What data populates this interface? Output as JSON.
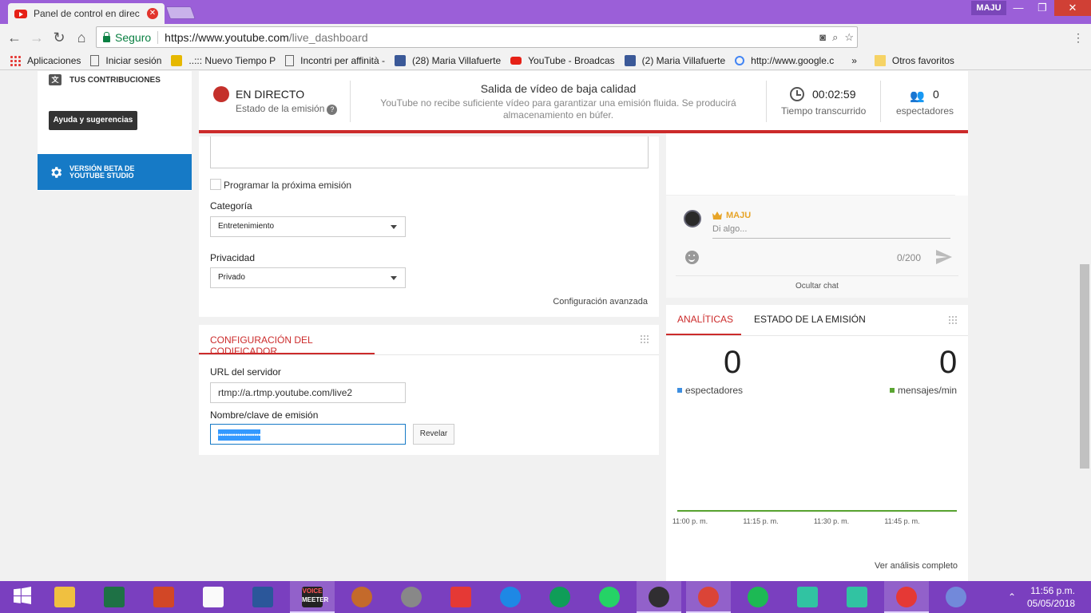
{
  "browser": {
    "tab_title": "Panel de control en direc",
    "tab_close": "✕",
    "profile": "MAJU",
    "window_controls": {
      "minimize": "—",
      "restore": "❐",
      "close": "✕"
    },
    "nav": {
      "back": "←",
      "forward": "→",
      "reload": "↻",
      "home": "⌂"
    },
    "secure_label": "Seguro",
    "url_host": "https://www.youtube.com",
    "url_path": "/live_dashboard",
    "bookmarks": [
      {
        "label": "Aplicaciones",
        "icon": "apps-grid-icon"
      },
      {
        "label": "Iniciar sesión",
        "icon": "page-icon"
      },
      {
        "label": "..::: Nuevo Tiempo P",
        "icon": "shield-icon"
      },
      {
        "label": "Incontri per affinità -",
        "icon": "eharmony-icon"
      },
      {
        "label": "(28) Maria Villafuerte",
        "icon": "facebook-icon"
      },
      {
        "label": "YouTube - Broadcas",
        "icon": "youtube-icon"
      },
      {
        "label": "(2) Maria Villafuerte",
        "icon": "facebook-icon"
      },
      {
        "label": "http://www.google.c",
        "icon": "google-icon"
      }
    ],
    "bookmarks_overflow": "»",
    "other_bookmarks": "Otros favoritos"
  },
  "sidebar": {
    "contributions": "TUS CONTRIBUCIONES",
    "help_button": "Ayuda y sugerencias",
    "beta_line1": "VERSIÓN BETA DE",
    "beta_line2": "YOUTUBE STUDIO"
  },
  "status": {
    "live_title": "EN DIRECTO",
    "live_sub": "Estado de la emisión",
    "help": "?",
    "quality_title": "Salida de vídeo de baja calidad",
    "quality_sub": "YouTube no recibe suficiente vídeo para garantizar una emisión fluida. Se producirá almacenamiento en búfer.",
    "elapsed_value": "00:02:59",
    "elapsed_label": "Tiempo transcurrido",
    "viewers_value": "0",
    "viewers_label": "espectadores"
  },
  "form": {
    "schedule_label": "Programar la próxima emisión",
    "category_label": "Categoría",
    "category_value": "Entretenimiento",
    "privacy_label": "Privacidad",
    "privacy_value": "Privado",
    "advanced_link": "Configuración avanzada"
  },
  "encoder": {
    "tab_label": "CONFIGURACIÓN DEL CODIFICADOR",
    "server_url_label": "URL del servidor",
    "server_url_value": "rtmp://a.rtmp.youtube.com/live2",
    "stream_key_label": "Nombre/clave de emisión",
    "stream_key_value": "••••••••••••••••••••",
    "reveal_button": "Revelar"
  },
  "chat": {
    "user": "MAJU",
    "placeholder": "Di algo...",
    "char_count": "0/200",
    "hide_chat": "Ocultar chat"
  },
  "analytics": {
    "tab_active": "ANALÍTICAS",
    "tab_other": "ESTADO DE LA EMISIÓN",
    "viewers_value": "0",
    "viewers_label": "espectadores",
    "messages_value": "0",
    "messages_label": "mensajes/min",
    "full_link": "Ver análisis completo",
    "colors": {
      "viewers": "#3d8ee0",
      "messages": "#5aa532"
    }
  },
  "chart_data": {
    "type": "line",
    "x": [
      "11:00 p. m.",
      "11:15 p. m.",
      "11:30 p. m.",
      "11:45 p. m."
    ],
    "series": [
      {
        "values": [
          0,
          0,
          0,
          0
        ],
        "color": "#5aa532"
      }
    ],
    "ylim": [
      0,
      1
    ],
    "grid": false
  },
  "taskbar": {
    "items": [
      {
        "icon": "windows-start-icon"
      },
      {
        "icon": "file-explorer-icon"
      },
      {
        "icon": "excel-icon"
      },
      {
        "icon": "powerpoint-icon"
      },
      {
        "icon": "document-icon"
      },
      {
        "icon": "word-icon"
      },
      {
        "icon": "voicemeeter-icon",
        "label_top": "VOICE",
        "label_bottom": "MEETER"
      },
      {
        "icon": "baseball-glove-icon"
      },
      {
        "icon": "film-reel-icon"
      },
      {
        "icon": "video-editor-icon"
      },
      {
        "icon": "edge-icon"
      },
      {
        "icon": "hangouts-icon"
      },
      {
        "icon": "whatsapp-icon"
      },
      {
        "icon": "obs-icon"
      },
      {
        "icon": "chrome-icon"
      },
      {
        "icon": "spotify-icon"
      },
      {
        "icon": "streamlabs-icon"
      },
      {
        "icon": "streamlabs-icon"
      },
      {
        "icon": "record-app-icon"
      },
      {
        "icon": "discord-icon"
      }
    ],
    "tray_chevron": "⌃",
    "time": "11:56 p.m.",
    "date": "05/05/2018"
  }
}
